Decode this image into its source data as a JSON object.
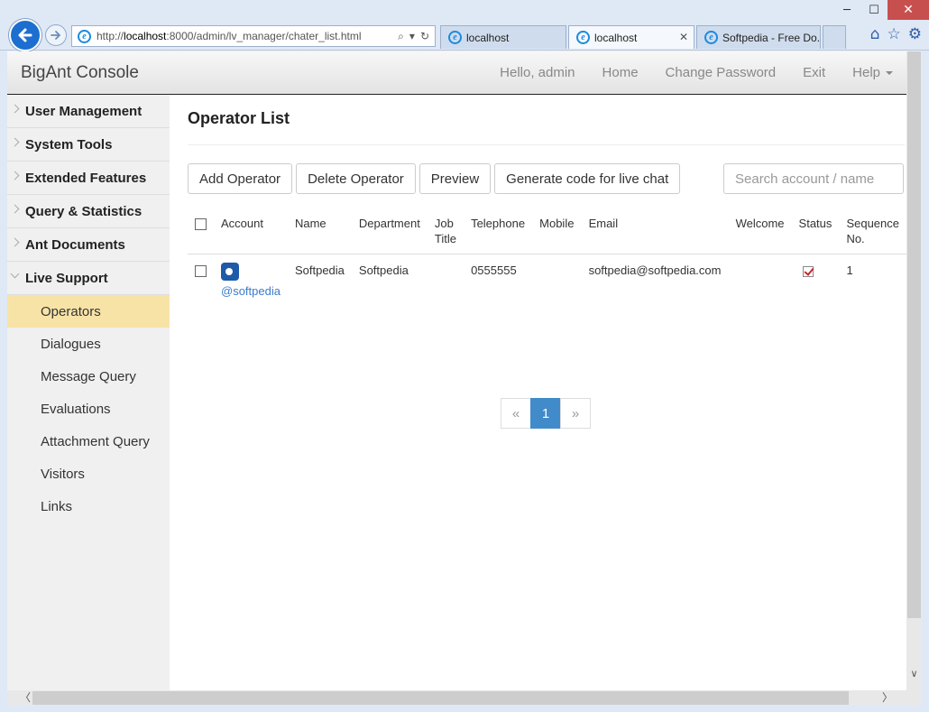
{
  "browser": {
    "url_prefix": "http://",
    "url_host": "localhost",
    "url_rest": ":8000/admin/lv_manager/chater_list.html",
    "tabs": [
      {
        "label": "localhost",
        "active": false
      },
      {
        "label": "localhost",
        "active": true
      },
      {
        "label": "Softpedia - Free Do...",
        "active": false
      }
    ],
    "window_controls": {
      "minimize": "─",
      "maximize": "☐",
      "close": "✕"
    },
    "icons": [
      "home-icon",
      "favorites-star-icon",
      "settings-gear-icon"
    ]
  },
  "app": {
    "brand": "BigAnt Console",
    "nav": {
      "greeting": "Hello, admin",
      "home": "Home",
      "change_password": "Change Password",
      "exit": "Exit",
      "help": "Help"
    }
  },
  "sidebar": {
    "groups": [
      {
        "label": "User Management",
        "open": false
      },
      {
        "label": "System Tools",
        "open": false
      },
      {
        "label": "Extended Features",
        "open": false
      },
      {
        "label": "Query & Statistics",
        "open": false
      },
      {
        "label": "Ant Documents",
        "open": false
      },
      {
        "label": "Live Support",
        "open": true
      }
    ],
    "live_support_items": [
      {
        "label": "Operators",
        "active": true
      },
      {
        "label": "Dialogues",
        "active": false
      },
      {
        "label": "Message Query",
        "active": false
      },
      {
        "label": "Evaluations",
        "active": false
      },
      {
        "label": "Attachment Query",
        "active": false
      },
      {
        "label": "Visitors",
        "active": false
      },
      {
        "label": "Links",
        "active": false
      }
    ]
  },
  "main": {
    "title": "Operator List",
    "buttons": {
      "add": "Add Operator",
      "delete": "Delete Operator",
      "preview": "Preview",
      "generate": "Generate code for live chat"
    },
    "search_placeholder": "Search account / name",
    "table": {
      "headers": {
        "account": "Account",
        "name": "Name",
        "department": "Department",
        "job_title": "Job Title",
        "telephone": "Telephone",
        "mobile": "Mobile",
        "email": "Email",
        "welcome": "Welcome",
        "status": "Status",
        "sequence": "Sequence No."
      },
      "rows": [
        {
          "account": "@softpedia",
          "name": "Softpedia",
          "department": "Softpedia",
          "job_title": "",
          "telephone": "0555555",
          "mobile": "",
          "email": "softpedia@softpedia.com",
          "welcome": "",
          "status_checked": true,
          "sequence": "1"
        }
      ]
    },
    "pagination": {
      "prev": "«",
      "current": "1",
      "next": "»"
    }
  }
}
